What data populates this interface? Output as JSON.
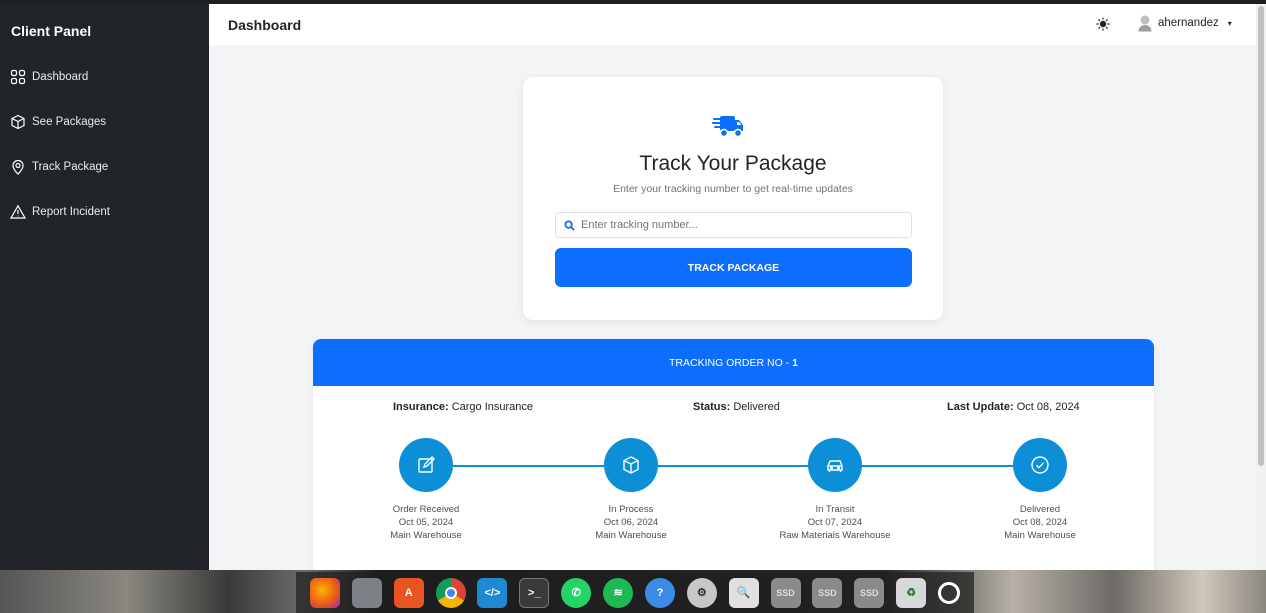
{
  "sidebar": {
    "title": "Client Panel",
    "items": [
      {
        "label": "Dashboard",
        "icon": "grid-icon"
      },
      {
        "label": "See Packages",
        "icon": "box-icon"
      },
      {
        "label": "Track Package",
        "icon": "location-pin-icon"
      },
      {
        "label": "Report Incident",
        "icon": "warning-triangle-icon"
      }
    ]
  },
  "topbar": {
    "title": "Dashboard",
    "username": "ahernandez",
    "caret": "▾"
  },
  "search_card": {
    "heading": "Track Your Package",
    "subtitle": "Enter your tracking number to get real-time updates",
    "placeholder": "Enter tracking number...",
    "button_label": "TRACK PACKAGE"
  },
  "tracking": {
    "header_prefix": "TRACKING ORDER NO -",
    "order_no": "1",
    "insurance_label": "Insurance:",
    "insurance_value": "Cargo Insurance",
    "status_label": "Status:",
    "status_value": "Delivered",
    "last_update_label": "Last Update:",
    "last_update_value": "Oct 08, 2024",
    "steps": [
      {
        "name": "Order Received",
        "date": "Oct 05, 2024",
        "location": "Main Warehouse",
        "icon": "edit-icon"
      },
      {
        "name": "In Process",
        "date": "Oct 06, 2024",
        "location": "Main Warehouse",
        "icon": "box-icon"
      },
      {
        "name": "In Transit",
        "date": "Oct 07, 2024",
        "location": "Raw Materials Warehouse",
        "icon": "car-icon"
      },
      {
        "name": "Delivered",
        "date": "Oct 08, 2024",
        "location": "Main Warehouse",
        "icon": "check-circle-icon"
      }
    ]
  },
  "taskbar": {
    "apps": [
      "firefox-icon",
      "files-icon",
      "app-center-icon",
      "chrome-icon",
      "vscode-icon",
      "terminal-icon",
      "whatsapp-icon",
      "spotify-icon",
      "help-icon",
      "settings-icon",
      "image-viewer-icon",
      "ssd-drive-icon",
      "ssd-drive-icon",
      "ssd-drive-icon",
      "trash-icon",
      "app-grid-icon"
    ],
    "drive_label": "SSD"
  },
  "colors": {
    "primary": "#0d6efd",
    "step_blue": "#0d8fd8",
    "sidebar_bg": "#212529"
  }
}
